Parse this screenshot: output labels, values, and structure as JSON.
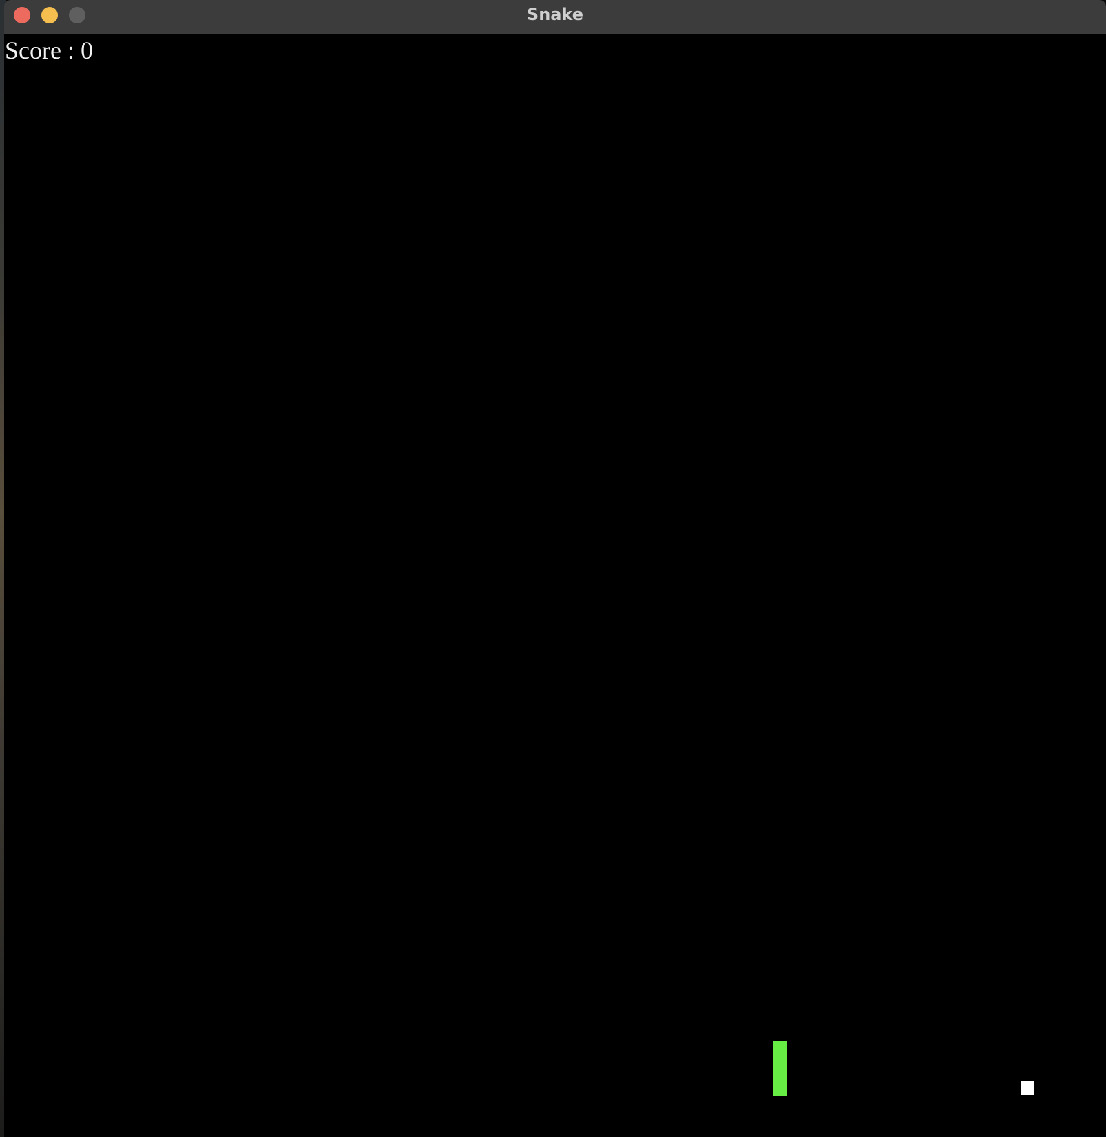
{
  "window": {
    "title": "Snake",
    "controls": [
      "close",
      "minimize",
      "zoom"
    ]
  },
  "game": {
    "score_text": "Score : 0",
    "score": 0,
    "colors": {
      "background": "#000000",
      "snake": "#66ee44",
      "food": "#ffffff",
      "text": "#f2f2f2"
    },
    "snake_segments": 2,
    "food_count": 1
  }
}
